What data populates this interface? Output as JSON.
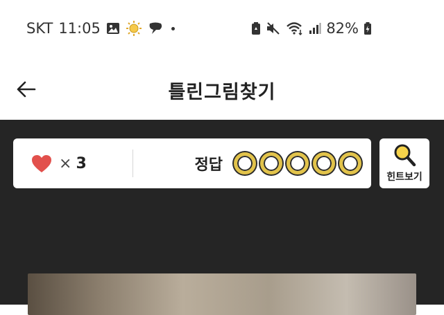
{
  "status_bar": {
    "carrier": "SKT",
    "time": "11:05",
    "battery": "82%"
  },
  "app_bar": {
    "title": "틀린그림찾기"
  },
  "game_info": {
    "lives_symbol": "×",
    "lives": "3",
    "answers_label": "정답",
    "answers_found": 0,
    "answers_total": 5
  },
  "hint": {
    "label": "힌트보기"
  },
  "colors": {
    "heart": "#e2504c",
    "slot_ring": "#e2c34a",
    "background_dark": "#252525"
  },
  "icons": [
    "back-arrow-icon",
    "heart-icon",
    "magnifier-icon",
    "gallery-icon",
    "sun-icon",
    "chat-icon",
    "mute-icon",
    "wifi-icon",
    "signal-icon",
    "battery-icon"
  ]
}
